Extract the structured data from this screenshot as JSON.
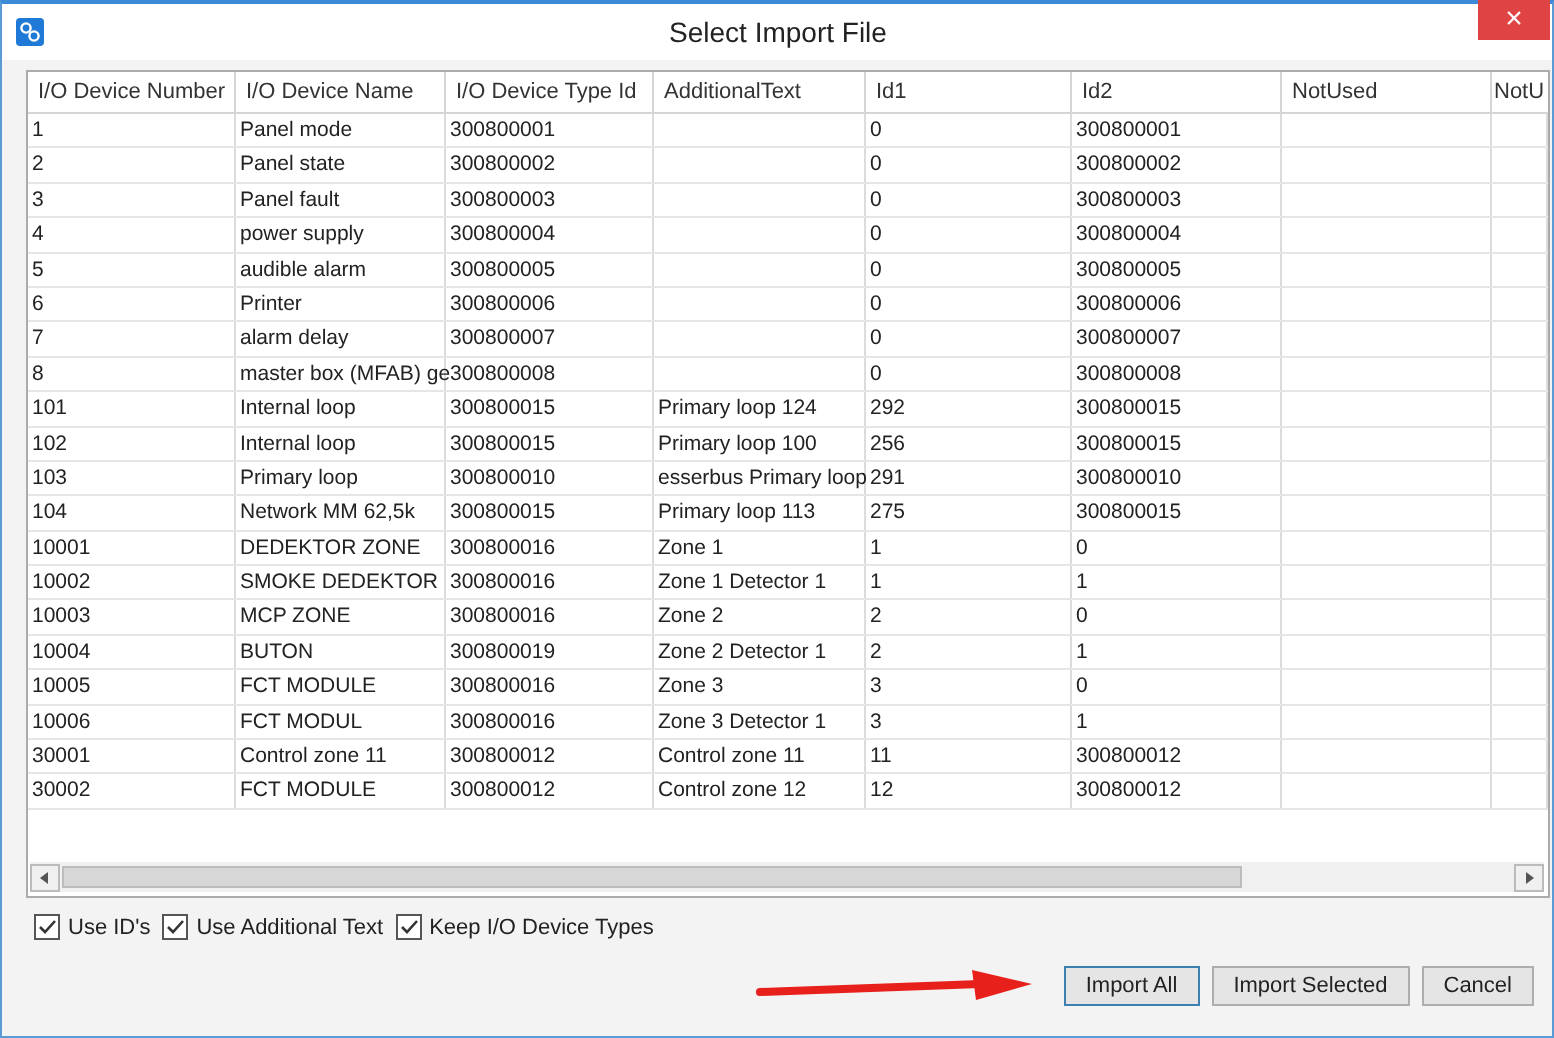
{
  "window": {
    "title": "Select Import File",
    "close": "×"
  },
  "table": {
    "columns": [
      "I/O Device Number",
      "I/O Device Name",
      "I/O Device Type Id",
      "AdditionalText",
      "Id1",
      "Id2",
      "NotUsed",
      "NotU"
    ],
    "rows": [
      {
        "number": "1",
        "name": "Panel mode",
        "type_id": "300800001",
        "id1": "0",
        "id2": "300800001"
      },
      {
        "number": "2",
        "name": "Panel state",
        "type_id": "300800002",
        "id1": "0",
        "id2": "300800002"
      },
      {
        "number": "3",
        "name": "Panel fault",
        "type_id": "300800003",
        "id1": "0",
        "id2": "300800003"
      },
      {
        "number": "4",
        "name": "power supply",
        "type_id": "300800004",
        "id1": "0",
        "id2": "300800004"
      },
      {
        "number": "5",
        "name": "audible alarm",
        "type_id": "300800005",
        "id1": "0",
        "id2": "300800005"
      },
      {
        "number": "6",
        "name": "Printer",
        "type_id": "300800006",
        "id1": "0",
        "id2": "300800006"
      },
      {
        "number": "7",
        "name": "alarm delay",
        "type_id": "300800007",
        "id1": "0",
        "id2": "300800007"
      },
      {
        "number": "8",
        "name": "master box (MFAB) ge",
        "type_id": "300800008",
        "id1": "0",
        "id2": "300800008"
      },
      {
        "number": "101",
        "name": "Internal loop",
        "type_id": "300800015",
        "additional_text": "Primary loop 124",
        "id1": "292",
        "id2": "300800015"
      },
      {
        "number": "102",
        "name": "Internal loop",
        "type_id": "300800015",
        "additional_text": "Primary loop 100",
        "id1": "256",
        "id2": "300800015"
      },
      {
        "number": "103",
        "name": "Primary loop",
        "type_id": "300800010",
        "additional_text": "esserbus Primary loop",
        "id1": "291",
        "id2": "300800010"
      },
      {
        "number": "104",
        "name": "Network MM 62,5k",
        "type_id": "300800015",
        "additional_text": "Primary loop 113",
        "id1": "275",
        "id2": "300800015"
      },
      {
        "number": "10001",
        "name": "DEDEKTOR ZONE",
        "type_id": "300800016",
        "additional_text": "Zone 1",
        "id1": "1",
        "id2": "0"
      },
      {
        "number": "10002",
        "name": "SMOKE DEDEKTOR",
        "type_id": "300800016",
        "additional_text": "Zone 1 Detector 1",
        "id1": "1",
        "id2": "1"
      },
      {
        "number": "10003",
        "name": "MCP ZONE",
        "type_id": "300800016",
        "additional_text": "Zone 2",
        "id1": "2",
        "id2": "0"
      },
      {
        "number": "10004",
        "name": "BUTON",
        "type_id": "300800019",
        "additional_text": "Zone 2 Detector 1",
        "id1": "2",
        "id2": "1"
      },
      {
        "number": "10005",
        "name": "FCT MODULE",
        "type_id": "300800016",
        "additional_text": "Zone 3",
        "id1": "3",
        "id2": "0"
      },
      {
        "number": "10006",
        "name": "FCT MODUL",
        "type_id": "300800016",
        "additional_text": "Zone 3 Detector 1",
        "id1": "3",
        "id2": "1"
      },
      {
        "number": "30001",
        "name": "Control zone 11",
        "type_id": "300800012",
        "additional_text": "Control zone 11",
        "id1": "11",
        "id2": "300800012"
      },
      {
        "number": "30002",
        "name": "FCT MODULE",
        "type_id": "300800012",
        "additional_text": "Control zone 12",
        "id1": "12",
        "id2": "300800012"
      }
    ]
  },
  "options": [
    {
      "label": "Use ID's",
      "checked": true
    },
    {
      "label": "Use Additional Text",
      "checked": true
    },
    {
      "label": "Keep I/O Device Types",
      "checked": true
    }
  ],
  "buttons": [
    {
      "label": "Import All",
      "default": true
    },
    {
      "label": "Import Selected",
      "default": false
    },
    {
      "label": "Cancel",
      "default": false
    }
  ]
}
